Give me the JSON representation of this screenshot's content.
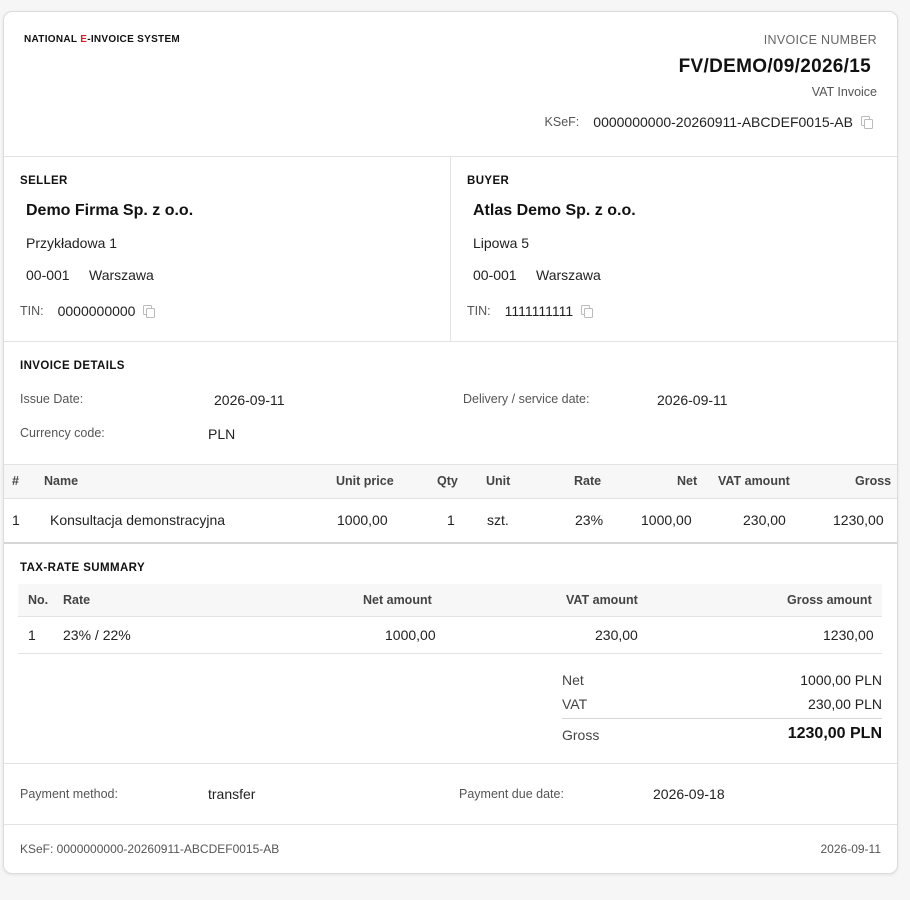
{
  "header": {
    "brand_prefix": "NATIONAL ",
    "brand_accent": "E",
    "brand_suffix": "-INVOICE SYSTEM",
    "invoice_number_label": "INVOICE NUMBER",
    "invoice_number": "FV/DEMO/09/2026/15",
    "invoice_type": "VAT Invoice",
    "ksef_label": "KSeF:",
    "ksef_number": "0000000000-20260911-ABCDEF0015-AB"
  },
  "seller": {
    "title": "SELLER",
    "name": "Demo Firma Sp. z o.o.",
    "street": "Przykładowa 1",
    "postal": "00-001",
    "city": "Warszawa",
    "tin_label": "TIN:",
    "tin": "0000000000"
  },
  "buyer": {
    "title": "BUYER",
    "name": "Atlas Demo Sp. z o.o.",
    "street": "Lipowa 5",
    "postal": "00-001",
    "city": "Warszawa",
    "tin_label": "TIN:",
    "tin": "1111111111"
  },
  "details": {
    "title": "INVOICE DETAILS",
    "issue_date_label": "Issue Date:",
    "issue_date": "2026-09-11",
    "delivery_label": "Delivery / service date:",
    "delivery_date": "2026-09-11",
    "currency_label": "Currency code:",
    "currency": "PLN"
  },
  "items": {
    "columns": [
      "#",
      "Name",
      "Unit price",
      "Qty",
      "Unit",
      "Rate",
      "Net",
      "VAT amount",
      "Gross"
    ],
    "rows": [
      [
        "1",
        "Konsultacja demonstracyjna",
        "1000,00",
        "1",
        "szt.",
        "23%",
        "1000,00",
        "230,00",
        "1230,00"
      ]
    ]
  },
  "tax_summary": {
    "title": "TAX-RATE SUMMARY",
    "columns": [
      "No.",
      "Rate",
      "Net amount",
      "VAT amount",
      "Gross amount"
    ],
    "rows": [
      [
        "1",
        "23% / 22%",
        "1000,00",
        "230,00",
        "1230,00"
      ]
    ]
  },
  "totals": {
    "net_label": "Net",
    "net": "1000,00 PLN",
    "vat_label": "VAT",
    "vat": "230,00 PLN",
    "gross_label": "Gross",
    "gross": "1230,00 PLN"
  },
  "payment": {
    "method_label": "Payment method:",
    "method": "transfer",
    "due_label": "Payment due date:",
    "due_date": "2026-09-18"
  },
  "footer": {
    "ksef": "KSeF: 0000000000-20260911-ABCDEF0015-AB",
    "date": "2026-09-11"
  },
  "colors": {
    "accent": "#d4202a",
    "border": "#e3e3e3",
    "table_header_bg": "#f7f7f7"
  }
}
